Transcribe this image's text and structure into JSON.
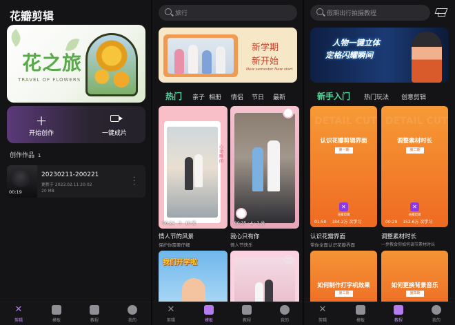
{
  "panel1": {
    "app_title": "花瓣剪辑",
    "hero": {
      "title": "花之旅",
      "subtitle": "TRAVEL OF FLOWERS"
    },
    "actions": [
      {
        "label": "开始创作",
        "icon": "plus-icon"
      },
      {
        "label": "一键成片",
        "icon": "video-camera-icon"
      }
    ],
    "works_label": "创作作品",
    "works_count": "1",
    "work": {
      "name": "20230211-200221",
      "updated": "更新于 2023.02.11 20:02",
      "size": "20 MB",
      "duration": "00:19"
    }
  },
  "panel2": {
    "search_placeholder": "旅行",
    "banner": {
      "line1": "新学期",
      "line2": "新开始",
      "sub": "New semester New start"
    },
    "categories": [
      "热门",
      "亲子",
      "相册",
      "情侣",
      "节日",
      "最新"
    ],
    "active_category": "热门",
    "cards": [
      {
        "title": "情人节的风景",
        "subtitle": "保护你需要仔细",
        "meta": "00:24 · 3 · 10 分",
        "vertical_text": "心动瞬间"
      },
      {
        "title": "我心只有你",
        "subtitle": "情人节快乐",
        "meta": "00:35 · 4 · 1 分"
      },
      {
        "title": "",
        "subtitle": "",
        "overlay": "我们开学啦"
      },
      {
        "title": "",
        "subtitle": "",
        "overlay": "😍"
      }
    ]
  },
  "panel3": {
    "search_placeholder": "假期出行拍摄教程",
    "banner": {
      "line1": "人物一键立体",
      "line2": "定格闪耀瞬间"
    },
    "categories": [
      "新手入门",
      "热门玩法",
      "创意剪辑"
    ],
    "active_category": "新手入门",
    "tutorials": [
      {
        "card_title": "认识花瓣剪辑界面",
        "episode": "第一期",
        "time": "01:50",
        "views": "184.2万 次学习",
        "title": "认识花瓣界面",
        "subtitle": "带你全面认识花瓣界面",
        "brand": "花瓣剪辑"
      },
      {
        "card_title": "调整素材时长",
        "episode": "第二期",
        "time": "00:29",
        "views": "152.6万 次学习",
        "title": "调整素材时长",
        "subtitle": "一步教会你如何调节素材时长",
        "brand": "花瓣剪辑"
      },
      {
        "card_title": "如何制作打字机效果",
        "episode": "第三期"
      },
      {
        "card_title": "如何更换背景音乐",
        "episode": "第四期"
      }
    ],
    "watermark": "DETAIL CUT"
  },
  "tabbars": [
    {
      "tabs": [
        {
          "label": "剪辑",
          "icon": "edit-x-icon"
        },
        {
          "label": "模板",
          "icon": "template-icon"
        },
        {
          "label": "教程",
          "icon": "tutorial-icon"
        },
        {
          "label": "我的",
          "icon": "avatar-icon"
        }
      ],
      "active": 0
    },
    {
      "tabs": [
        {
          "label": "剪辑",
          "icon": "edit-x-icon"
        },
        {
          "label": "模板",
          "icon": "template-icon"
        },
        {
          "label": "教程",
          "icon": "tutorial-icon"
        },
        {
          "label": "我的",
          "icon": "avatar-icon"
        }
      ],
      "active": 1
    },
    {
      "tabs": [
        {
          "label": "剪辑",
          "icon": "edit-x-icon"
        },
        {
          "label": "模板",
          "icon": "template-icon"
        },
        {
          "label": "教程",
          "icon": "tutorial-icon"
        },
        {
          "label": "我的",
          "icon": "avatar-icon"
        }
      ],
      "active": 2
    }
  ],
  "colors": {
    "accent_green": "#56d39b",
    "accent_purple": "#b57cf0",
    "background": "#141416"
  }
}
